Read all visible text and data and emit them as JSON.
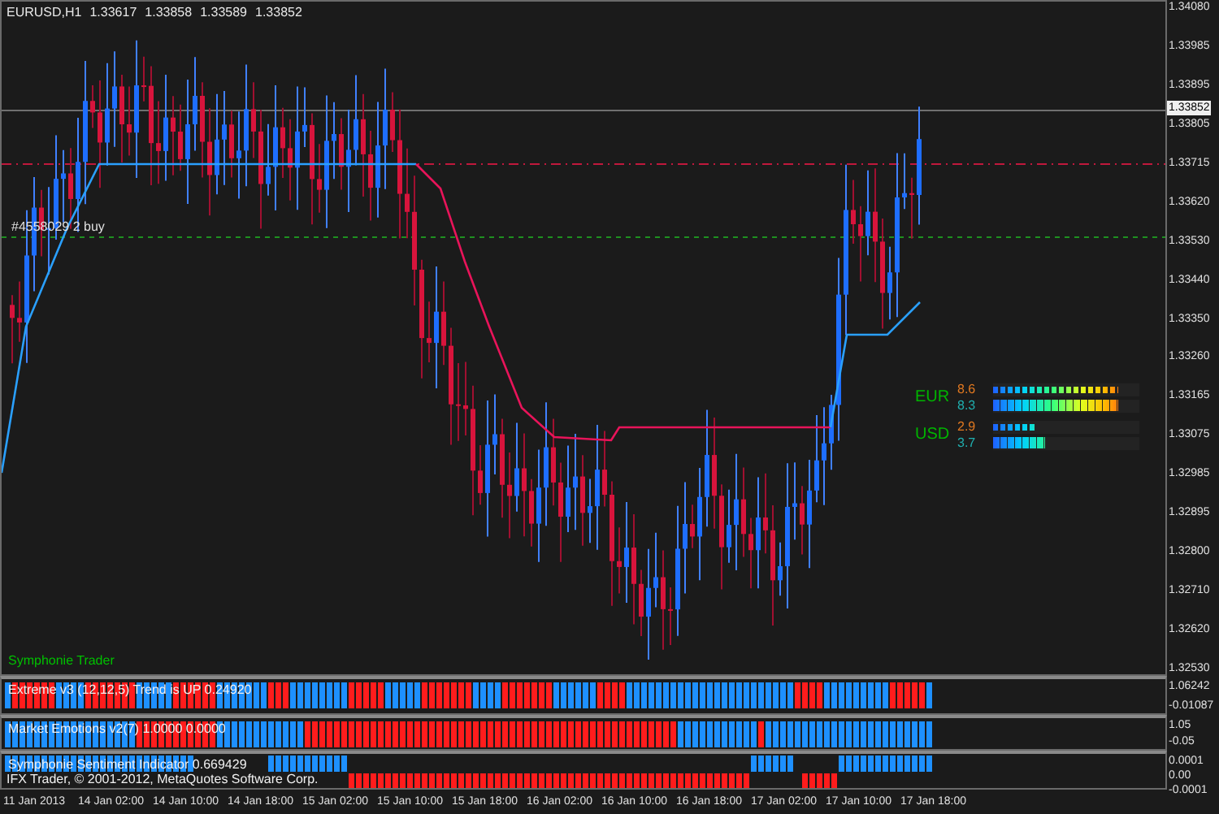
{
  "chart": {
    "symbol": "EURUSD,H1",
    "ohlc": [
      "1.33617",
      "1.33858",
      "1.33589",
      "1.33852"
    ],
    "order_label": "#4558029 2 buy",
    "indicator_name": "Symphonie Trader"
  },
  "strength_meter": [
    {
      "currency": "EUR",
      "rows": [
        {
          "reading": "8.6",
          "level": 0.85,
          "kind": "thin"
        },
        {
          "reading": "8.3",
          "level": 0.85,
          "kind": "thick"
        }
      ]
    },
    {
      "currency": "USD",
      "rows": [
        {
          "reading": "2.9",
          "level": 0.3,
          "kind": "thin"
        },
        {
          "reading": "3.7",
          "level": 0.35,
          "kind": "thick"
        }
      ]
    }
  ],
  "price_axis": {
    "ticks": [
      "1.34080",
      "1.33985",
      "1.33895",
      "1.33805",
      "1.33715",
      "1.33620",
      "1.33530",
      "1.33440",
      "1.33350",
      "1.33260",
      "1.33165",
      "1.33075",
      "1.32985",
      "1.32895",
      "1.32800",
      "1.32710",
      "1.32620",
      "1.32530"
    ],
    "current": "1.33852"
  },
  "panels": [
    {
      "label": "Extreme v3 (12,12,5) Trend is UP 0.24920",
      "axis": [
        "1.06242",
        "-0.01087"
      ]
    },
    {
      "label": "Market Emotions v2(7) 1.0000 0.0000",
      "axis": [
        "1.05",
        "-0.05"
      ]
    },
    {
      "label": "Symphonie Sentiment Indicator 0.669429",
      "axis": [
        "0.0001",
        "0.00",
        "-0.0001"
      ]
    }
  ],
  "copyright": "IFX Trader, © 2001-2012, MetaQuotes Software Corp.",
  "time_axis": [
    "11 Jan 2013",
    "14 Jan 02:00",
    "14 Jan 10:00",
    "14 Jan 18:00",
    "15 Jan 02:00",
    "15 Jan 10:00",
    "15 Jan 18:00",
    "16 Jan 02:00",
    "16 Jan 10:00",
    "16 Jan 18:00",
    "17 Jan 02:00",
    "17 Jan 10:00",
    "17 Jan 18:00"
  ]
}
